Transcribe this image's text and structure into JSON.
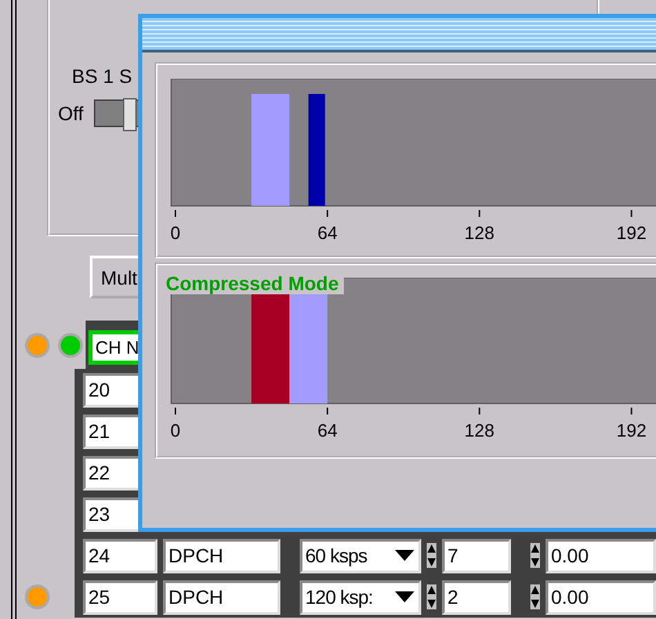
{
  "settings_group": {
    "label": "BS 1 S",
    "switch_label": "Off",
    "switch_on": false
  },
  "multi_button": "Mult",
  "channel_table": {
    "header": "CH N",
    "header_leds": [
      {
        "color": "#ff9900"
      },
      {
        "color": "#00cc00"
      }
    ],
    "rows": [
      {
        "number": "20"
      },
      {
        "number": "21"
      },
      {
        "number": "22"
      },
      {
        "number": "23"
      },
      {
        "number": "24",
        "type": "DPCH",
        "rate": "60 ksps",
        "value_1": "7",
        "value_2": "0.00"
      },
      {
        "number": "25",
        "type": "DPCH",
        "rate": "120 ksp:",
        "value_1": "2",
        "value_2": "0.00",
        "led": {
          "color": "#ff9900"
        }
      }
    ]
  },
  "overlay_window": {
    "plots": [
      {
        "axis_labels": [
          "0",
          "64",
          "128",
          "192"
        ]
      },
      {
        "label": "Compressed Mode",
        "axis_labels": [
          "0",
          "64",
          "128",
          "192"
        ]
      }
    ]
  }
}
